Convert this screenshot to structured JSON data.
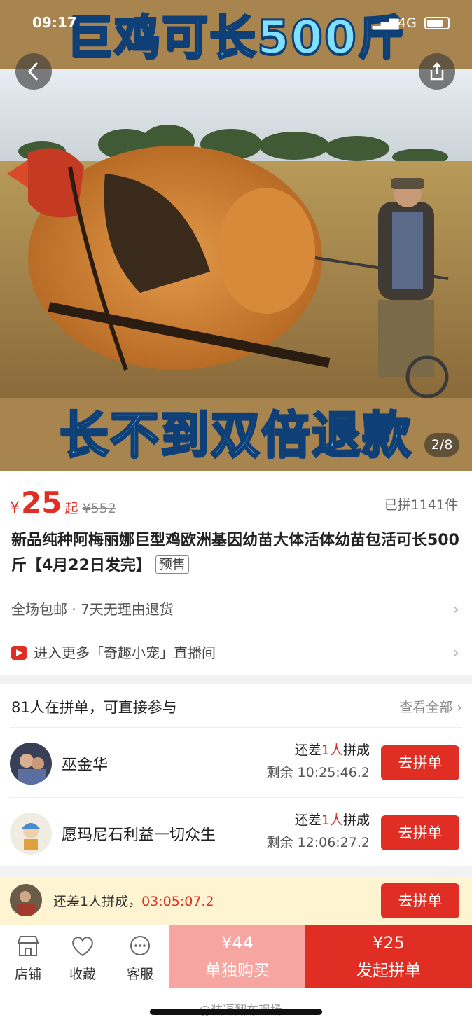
{
  "status_bar": {
    "time": "09:17",
    "network": "4G"
  },
  "hero": {
    "headline_top": "巨鸡可长500斤",
    "headline_bottom": "长不到双倍退款",
    "image_counter": "2/8"
  },
  "product": {
    "currency": "¥",
    "price": "25",
    "price_suffix": "起",
    "original_price": "¥552",
    "sold": "已拼1141件",
    "title": "新品纯种阿梅丽娜巨型鸡欧洲基因幼苗大体活体幼苗包活可长500斤【4月22日发完】",
    "presale_tag": "预售",
    "service": "全场包邮 · 7天无理由退货",
    "live_entry": "进入更多「奇趣小宠」直播间"
  },
  "groups": {
    "header": "81人在拼单，可直接参与",
    "view_all": "查看全部",
    "rows": [
      {
        "name": "巫金华",
        "need_prefix": "还差",
        "need_count": "1人",
        "need_suffix": "拼成",
        "remaining": "剩余 10:25:46.2",
        "button": "去拼单"
      },
      {
        "name": "愿玛尼石利益一切众生",
        "need_prefix": "还差",
        "need_count": "1人",
        "need_suffix": "拼成",
        "remaining": "剩余 12:06:27.2",
        "button": "去拼单"
      }
    ]
  },
  "promo_bar": {
    "message": "还差1人拼成，",
    "countdown": "03:05:07.2",
    "button": "去拼单"
  },
  "bottom_bar": {
    "tabs": [
      {
        "label": "店铺",
        "icon": "store-icon"
      },
      {
        "label": "收藏",
        "icon": "heart-icon"
      },
      {
        "label": "客服",
        "icon": "chat-icon"
      }
    ],
    "single_price": "¥44",
    "single_label": "单独购买",
    "group_price": "¥25",
    "group_label": "发起拼单"
  },
  "watermark": "@装逼翻车现场",
  "colors": {
    "accent": "#e02e24",
    "headline": "#7fe0ff",
    "promo_bg": "#fff4d2"
  }
}
